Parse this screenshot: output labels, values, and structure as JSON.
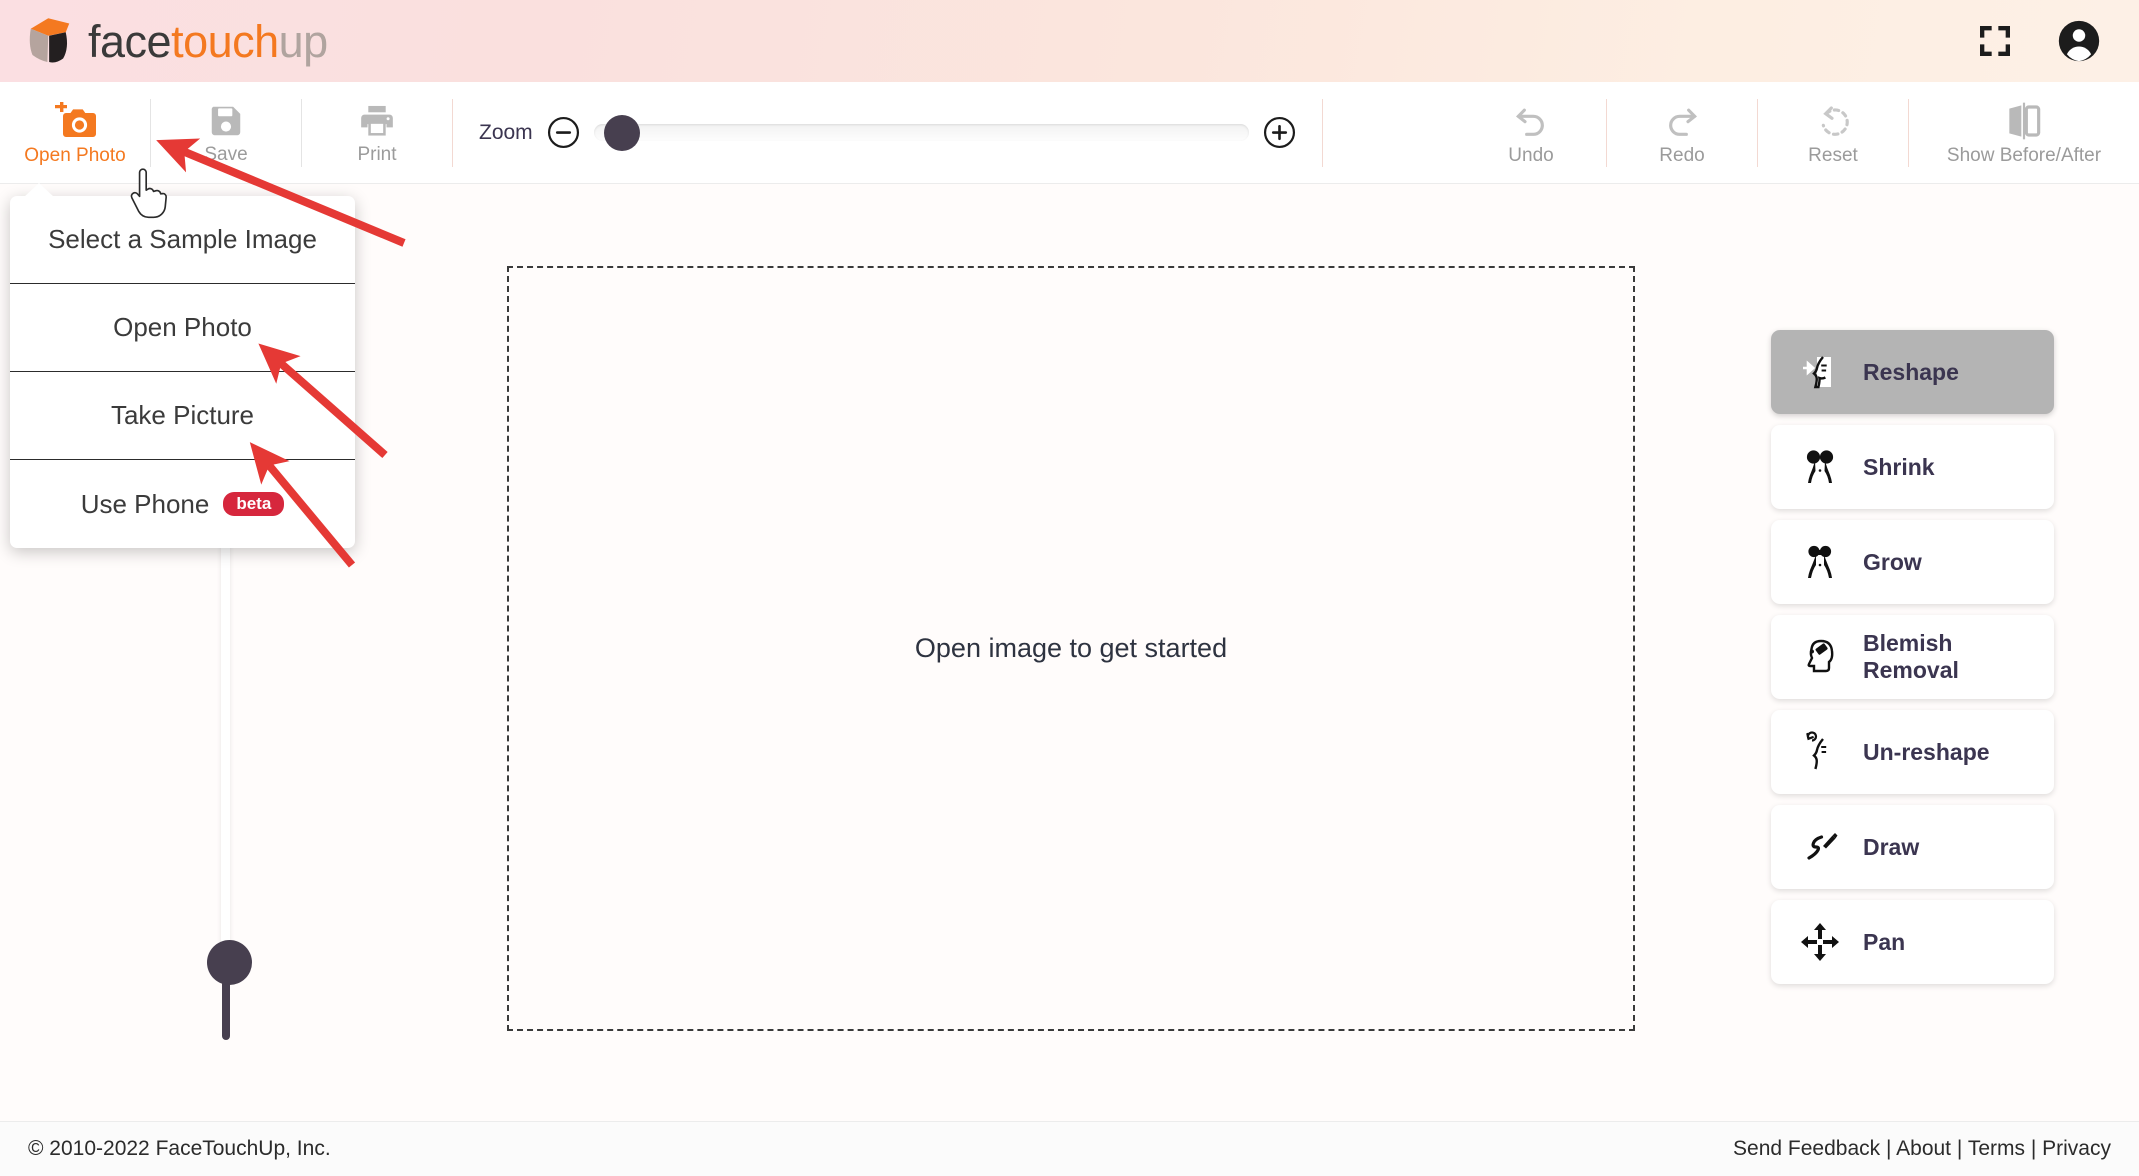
{
  "app": {
    "brand": {
      "part1": "face",
      "part2": "touch",
      "part3": "up"
    },
    "colors": {
      "accent_orange": "#f47920",
      "brand_gray": "#b0a49f",
      "header_pink": "#fbdfe2",
      "tool_selected": "#b4b4b4",
      "slider_thumb": "#473f4f",
      "beta_badge": "#d6273d",
      "annotation_arrow": "#e53935"
    }
  },
  "header": {
    "icons": [
      {
        "name": "fullscreen-icon",
        "label": "Fullscreen"
      },
      {
        "name": "account-circle-icon",
        "label": "Account"
      }
    ]
  },
  "toolbar": {
    "items": [
      {
        "label": "Open Photo",
        "icon": "camera-plus-icon",
        "active": true
      },
      {
        "label": "Save",
        "icon": "floppy-disk-icon",
        "active": false
      },
      {
        "label": "Print",
        "icon": "printer-icon",
        "active": false
      }
    ],
    "zoom": {
      "label": "Zoom",
      "minus_icon": "minus-circle-icon",
      "plus_icon": "plus-circle-icon",
      "value": 0,
      "min": 0,
      "max": 100
    },
    "right_items": [
      {
        "label": "Undo",
        "icon": "undo-arrow-icon"
      },
      {
        "label": "Redo",
        "icon": "redo-arrow-icon"
      },
      {
        "label": "Reset",
        "icon": "reset-dashed-circle-icon"
      },
      {
        "label": "Show Before/After",
        "icon": "before-after-split-icon"
      }
    ]
  },
  "dropdown": {
    "items": [
      {
        "label": "Select a Sample Image",
        "badge": null
      },
      {
        "label": "Open Photo",
        "badge": null
      },
      {
        "label": "Take Picture",
        "badge": null
      },
      {
        "label": "Use Phone",
        "badge": "beta"
      }
    ]
  },
  "vertical_slider": {
    "name": "brush-size-slider",
    "value": 12
  },
  "canvas": {
    "hint": "Open image to get started"
  },
  "tools": {
    "items": [
      {
        "label": "Reshape",
        "icon": "face-profile-arrow-icon",
        "selected": true
      },
      {
        "label": "Shrink",
        "icon": "torso-shrink-icon",
        "selected": false
      },
      {
        "label": "Grow",
        "icon": "torso-grow-icon",
        "selected": false
      },
      {
        "label": "Blemish Removal",
        "icon": "head-eraser-icon",
        "selected": false
      },
      {
        "label": "Un-reshape",
        "icon": "face-profile-undo-icon",
        "selected": false
      },
      {
        "label": "Draw",
        "icon": "pencil-icon",
        "selected": false
      },
      {
        "label": "Pan",
        "icon": "four-arrows-move-icon",
        "selected": false
      }
    ]
  },
  "footer": {
    "copyright": "© 2010-2022 FaceTouchUp, Inc.",
    "links": [
      {
        "label": "Send Feedback"
      },
      {
        "label": "About"
      },
      {
        "label": "Terms"
      },
      {
        "label": "Privacy"
      }
    ],
    "separator": "|"
  }
}
